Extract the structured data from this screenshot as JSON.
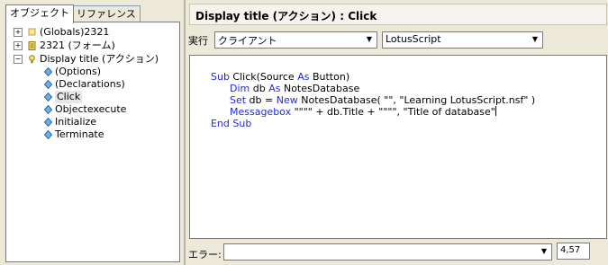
{
  "left_pane": {
    "tabs": [
      {
        "label": "オブジェクト",
        "active": true
      },
      {
        "label": "リファレンス",
        "active": false
      }
    ],
    "tree": [
      {
        "label": "(Globals)2321",
        "icon": "globals-icon",
        "expander": "+",
        "indent": 0
      },
      {
        "label": "2321 (フォーム)",
        "icon": "form-icon",
        "expander": "+",
        "indent": 0
      },
      {
        "label": "Display title (アクション)",
        "icon": "action-icon",
        "expander": "−",
        "indent": 0
      },
      {
        "label": "(Options)",
        "icon": "event-icon",
        "indent": 1
      },
      {
        "label": "(Declarations)",
        "icon": "event-icon",
        "indent": 1
      },
      {
        "label": "Click",
        "icon": "event-icon",
        "indent": 1,
        "selected": true
      },
      {
        "label": "Objectexecute",
        "icon": "event-icon",
        "indent": 1
      },
      {
        "label": "Initialize",
        "icon": "event-icon",
        "indent": 1
      },
      {
        "label": "Terminate",
        "icon": "event-icon",
        "indent": 1
      }
    ]
  },
  "right_pane": {
    "title": "Display title (アクション) : Click",
    "run_label": "実行",
    "run_select": "クライアント",
    "language_select": "LotusScript",
    "code_lines": [
      [
        {
          "t": "Sub ",
          "kw": true
        },
        {
          "t": "Click(Source ",
          "kw": false
        },
        {
          "t": "As ",
          "kw": true
        },
        {
          "t": "Button)",
          "kw": false
        }
      ],
      [
        {
          "t": "Dim ",
          "kw": true
        },
        {
          "t": "db ",
          "kw": false
        },
        {
          "t": "As ",
          "kw": true
        },
        {
          "t": "NotesDatabase",
          "kw": false
        }
      ],
      [
        {
          "t": "Set ",
          "kw": true
        },
        {
          "t": "db = ",
          "kw": false
        },
        {
          "t": "New ",
          "kw": true
        },
        {
          "t": "NotesDatabase( \"\", \"Learning LotusScript.nsf\" )",
          "kw": false
        }
      ],
      [
        {
          "t": "Messagebox ",
          "kw": true
        },
        {
          "t": "\"\"\"\" + db.Title + \"\"\"\", \"Title of database\"",
          "kw": false
        }
      ],
      [
        {
          "t": "End Sub",
          "kw": true
        }
      ]
    ],
    "error_label": "エラー:",
    "error_select": "",
    "cursor_position": "4,57"
  },
  "colors": {
    "keyword": "#1f2bd6",
    "background": "#ece9d8",
    "selection": "#e6e6e6"
  }
}
